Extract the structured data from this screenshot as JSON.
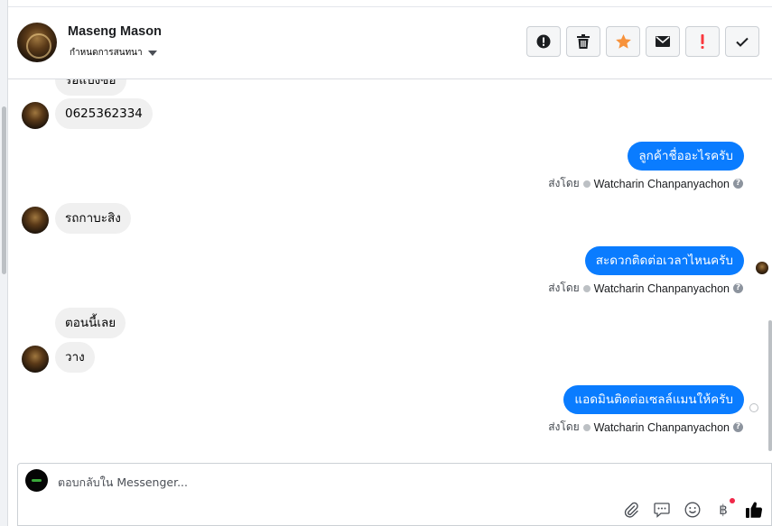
{
  "header": {
    "contact_name": "Maseng Mason",
    "subtitle": "กำหนดการสนทนา",
    "actions": [
      {
        "name": "spam-icon"
      },
      {
        "name": "trash-icon"
      },
      {
        "name": "star-icon"
      },
      {
        "name": "envelope-icon"
      },
      {
        "name": "exclamation-icon"
      },
      {
        "name": "check-icon"
      }
    ]
  },
  "messages": {
    "in_0": "รอแป้งซ่อ",
    "in_1": "0625362334",
    "out_1": "ลูกค้าชื่ออะไรครับ",
    "in_2": "รถกาบะสิง",
    "out_2": "สะดวกติดต่อเวลาไหนครับ",
    "in_3": "ตอนนี้เลย",
    "in_4": "วาง",
    "out_3": "แอดมินติดต่อเซลล์แมนให้ครับ"
  },
  "sent_by": {
    "label": "ส่งโดย",
    "agent_name": "Watcharin Chanpanyachon",
    "help": "?"
  },
  "composer": {
    "placeholder": "ตอบกลับใน Messenger...",
    "baht_symbol": "฿"
  },
  "colors": {
    "outgoing_bubble": "#0a7cff",
    "incoming_bubble": "#f0f0f0",
    "star": "#f7923b",
    "exclamation": "#fa383e",
    "like": "#050505"
  }
}
